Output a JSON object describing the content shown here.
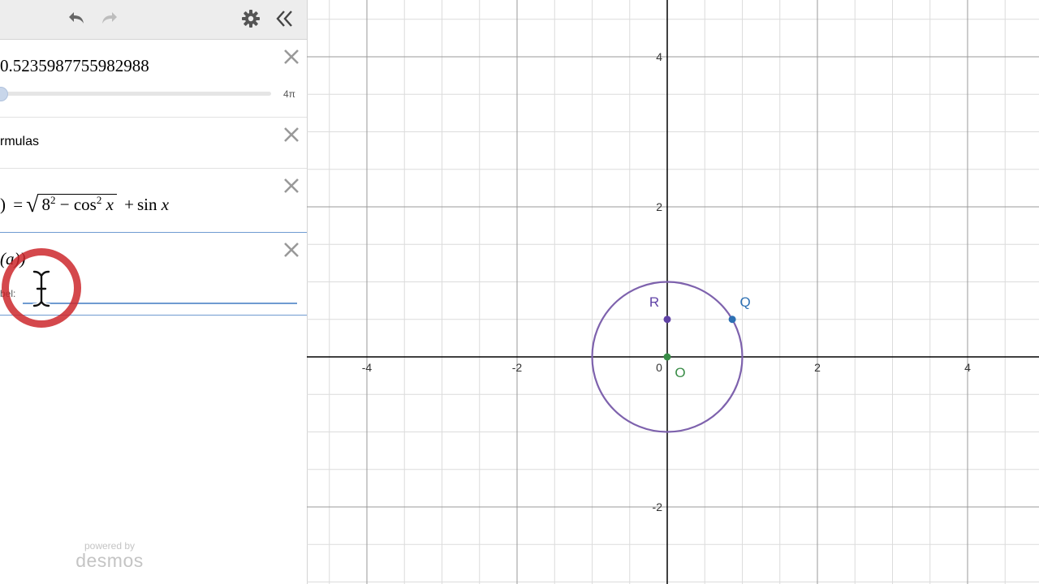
{
  "toolbar": {
    "undo_icon": "undo-icon",
    "redo_icon": "redo-icon",
    "settings_icon": "gear-icon",
    "collapse_icon": "double-chevron-left-icon"
  },
  "expressions": [
    {
      "type": "slider",
      "value_text": "0.5235987755982988",
      "slider_max": "4π",
      "slider_value": 0.5235987755982988
    },
    {
      "type": "note",
      "text": "rmulas"
    },
    {
      "type": "expression",
      "lhs": ")",
      "eq": "=",
      "radicand_base": "8",
      "radicand_exp": "2",
      "minus": "−",
      "cos_fn": "cos",
      "cos_exp": "2",
      "cos_var": "x",
      "plus": "+",
      "sin_fn": "sin",
      "sin_var": "x"
    },
    {
      "type": "point",
      "text": "(a))",
      "label_caption": "bel:",
      "label_value": ""
    }
  ],
  "branding": {
    "powered_by": "powered by",
    "name": "desmos"
  },
  "graph": {
    "x_range": [
      -4.9,
      4.9
    ],
    "y_range": [
      -3.0,
      4.7
    ],
    "grid": true,
    "x_ticks": [
      "-4",
      "-2",
      "0",
      "2",
      "4"
    ],
    "y_ticks": [
      "4",
      "2",
      "-2"
    ],
    "circle": {
      "center": [
        0,
        0
      ],
      "radius": 1,
      "color": "#7e62ad"
    },
    "points": [
      {
        "name": "R",
        "x": 0,
        "y": 0.5,
        "color": "#6042a6"
      },
      {
        "name": "Q",
        "x": 0.866,
        "y": 0.5,
        "color": "#2d70b3"
      },
      {
        "name": "O",
        "x": 0,
        "y": 0,
        "color": "#388c46"
      }
    ]
  }
}
